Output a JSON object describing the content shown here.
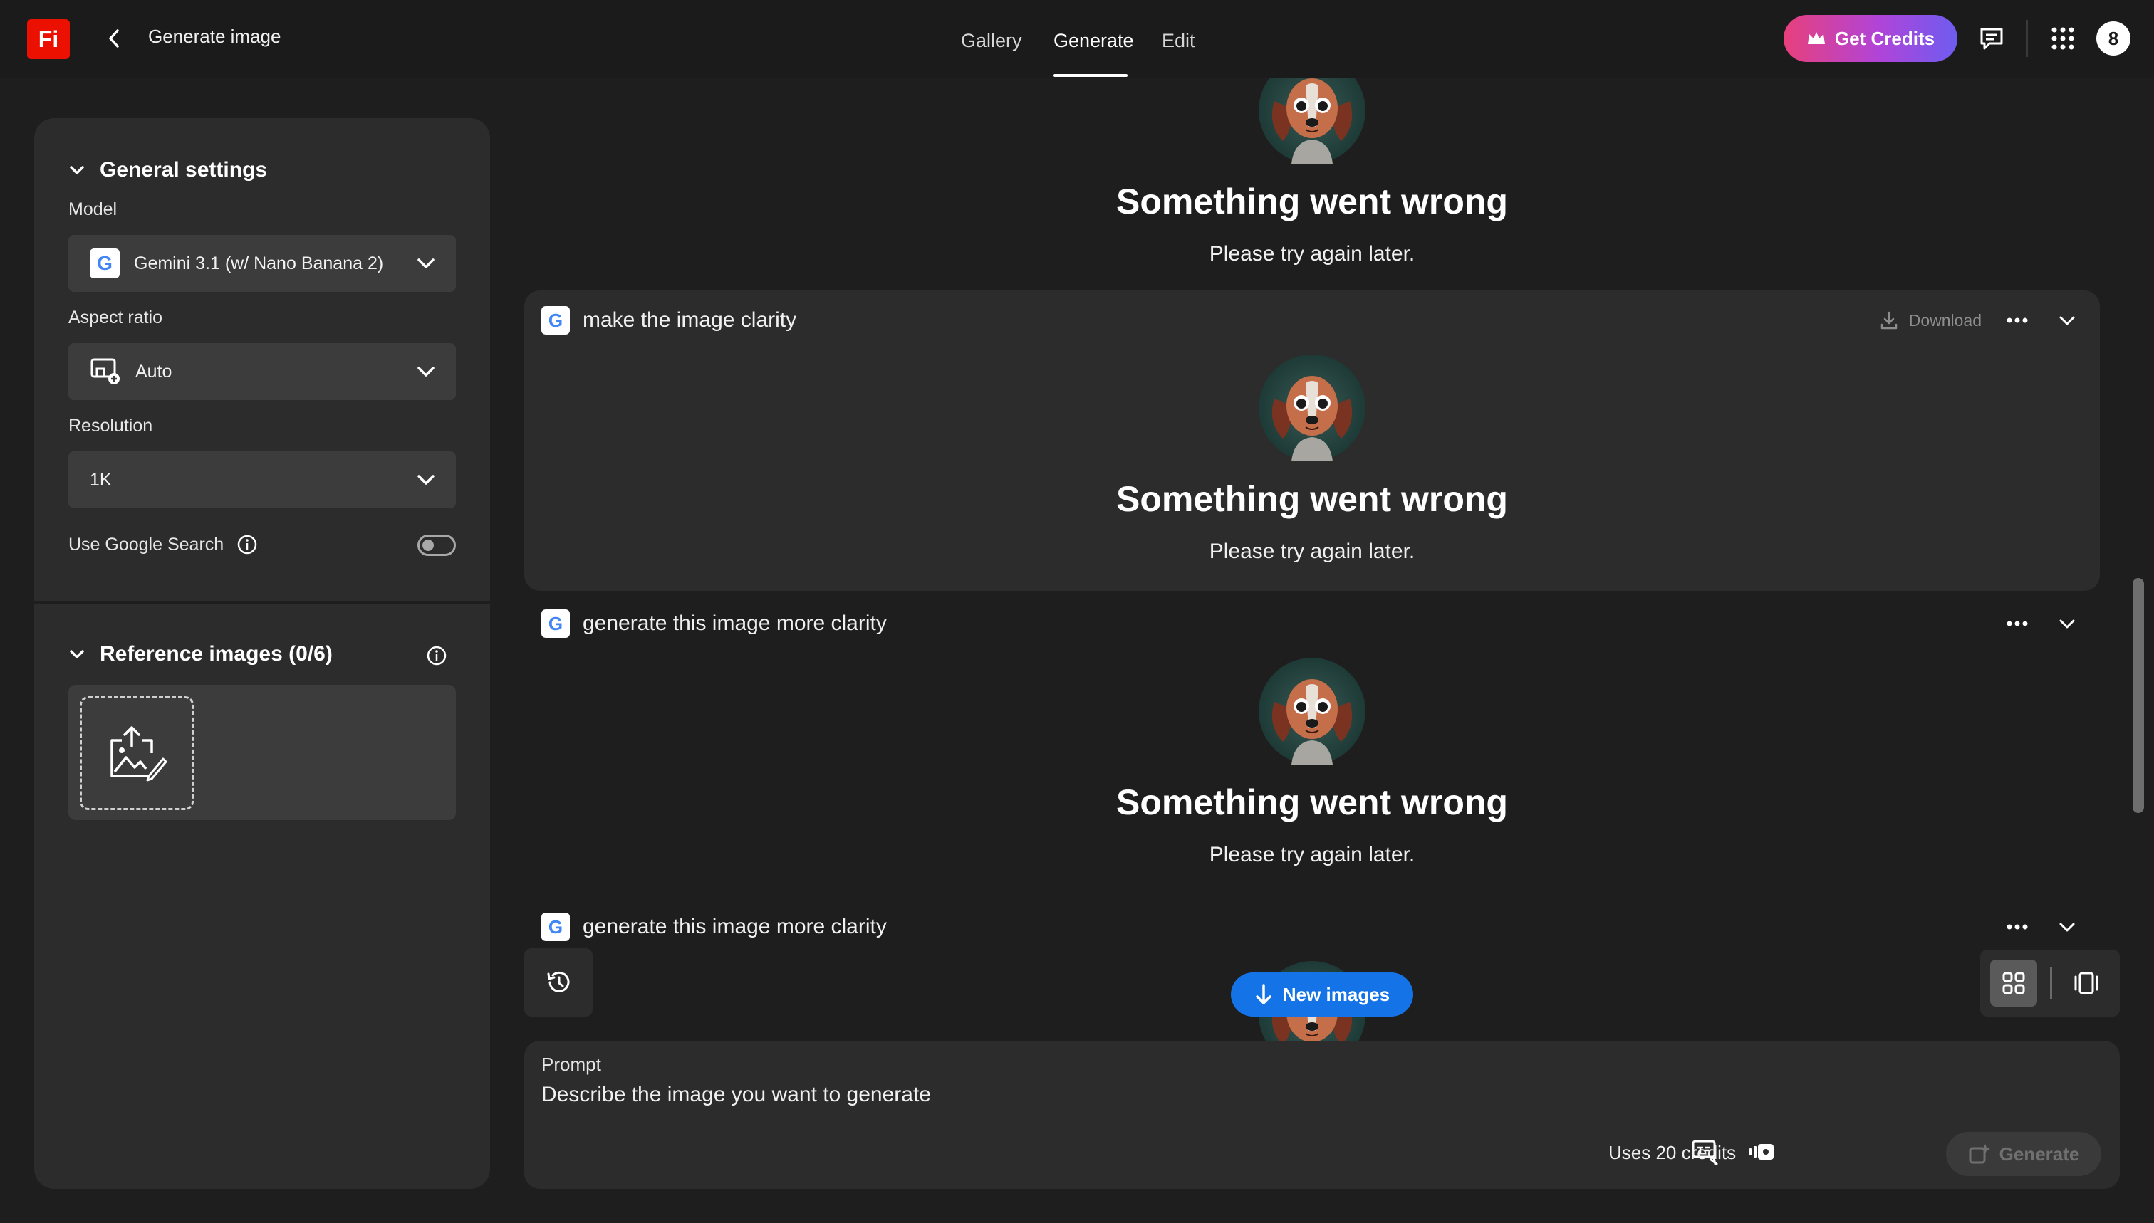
{
  "header": {
    "logo_text": "Fi",
    "title": "Generate image",
    "tabs": [
      {
        "label": "Gallery",
        "active": false
      },
      {
        "label": "Generate",
        "active": true
      },
      {
        "label": "Edit",
        "active": false
      }
    ],
    "get_credits_label": "Get Credits",
    "avatar_initial": "8"
  },
  "sidebar": {
    "general_settings_title": "General settings",
    "model": {
      "label": "Model",
      "value": "Gemini 3.1 (w/ Nano Banana 2)"
    },
    "aspect_ratio": {
      "label": "Aspect ratio",
      "value": "Auto"
    },
    "resolution": {
      "label": "Resolution",
      "value": "1K"
    },
    "google_search": {
      "label": "Use Google Search",
      "enabled": false
    },
    "reference_images_title": "Reference images (0/6)"
  },
  "feed": {
    "cards": [
      {
        "prompt": "",
        "error_title": "Something went wrong",
        "error_message": "Please try again later."
      },
      {
        "prompt": "make the image clarity",
        "download_label": "Download",
        "error_title": "Something went wrong",
        "error_message": "Please try again later."
      },
      {
        "prompt": "generate this image more clarity",
        "error_title": "Something went wrong",
        "error_message": "Please try again later."
      },
      {
        "prompt": "generate this image more clarity"
      }
    ],
    "new_images_label": "New images"
  },
  "prompt": {
    "label": "Prompt",
    "placeholder": "Describe the image you want to generate",
    "credits_text": "Uses 20 credits",
    "generate_label": "Generate"
  },
  "colors": {
    "brand_red": "#eb1000",
    "accent_blue": "#1473e6",
    "panel_bg": "#2c2c2c",
    "page_bg": "#1e1e1e"
  },
  "icons": [
    "back-chevron-icon",
    "crown-icon",
    "chat-icon",
    "apps-grid-icon",
    "google-icon",
    "aspect-ratio-icon",
    "info-icon",
    "upload-image-icon",
    "download-icon",
    "more-icon",
    "chevron-down-icon",
    "history-icon",
    "arrow-down-icon",
    "grid-view-icon",
    "single-view-icon",
    "style-reference-icon",
    "style-icon",
    "generate-icon"
  ]
}
